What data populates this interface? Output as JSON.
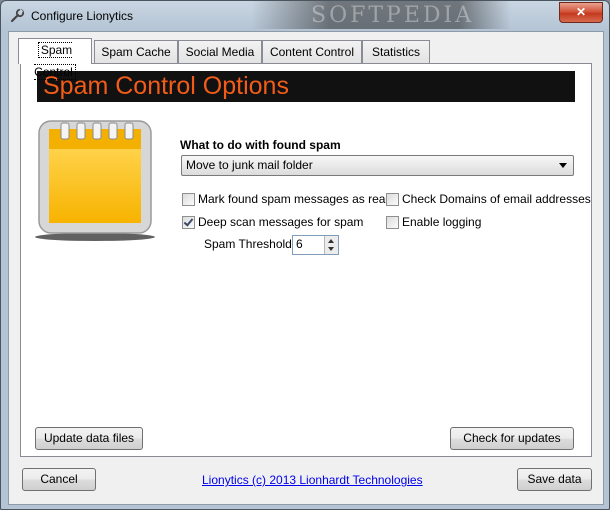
{
  "window": {
    "title": "Configure Lionytics",
    "close_glyph": "✕",
    "watermark": "SOFTPEDIA"
  },
  "tabs": [
    {
      "label": "Spam Control",
      "active": true
    },
    {
      "label": "Spam Cache",
      "active": false
    },
    {
      "label": "Social Media",
      "active": false
    },
    {
      "label": "Content Control",
      "active": false
    },
    {
      "label": "Statistics",
      "active": false
    }
  ],
  "spam": {
    "heading": "Spam Control Options",
    "action_label": "What to do with found spam",
    "action_value": "Move to junk mail folder",
    "options": {
      "mark_read": {
        "label": "Mark found spam messages as read",
        "checked": false
      },
      "check_domains": {
        "label": "Check Domains of email addresses",
        "checked": false
      },
      "deep_scan": {
        "label": "Deep scan messages for spam",
        "checked": true
      },
      "logging": {
        "label": "Enable logging",
        "checked": false
      }
    },
    "threshold_label": "Spam Threshold",
    "threshold_value": "6",
    "update_button": "Update data files",
    "check_updates_button": "Check for updates"
  },
  "footer": {
    "cancel_button": "Cancel",
    "link": "Lionytics (c) 2013 Lionhardt Technologies",
    "save_button": "Save data"
  },
  "colors": {
    "banner_bg": "#111111",
    "banner_text": "#f25c19",
    "notepad": "#fbc21c"
  },
  "icons": {
    "app": "wrench-icon",
    "panel": "notepad-icon"
  }
}
